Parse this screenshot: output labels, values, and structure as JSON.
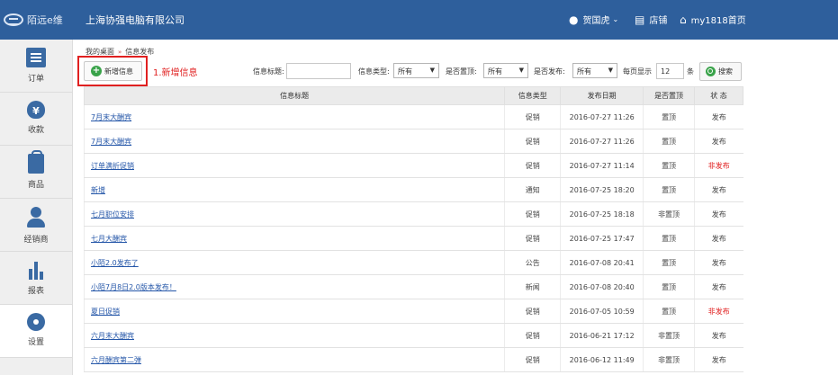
{
  "header": {
    "logo_text": "陌远e维",
    "company": "上海协强电脑有限公司",
    "user": "贺国虎",
    "shop": "店铺",
    "home": "my1818首页"
  },
  "sidebar": {
    "items": [
      {
        "label": "订单",
        "icon": "order-list-icon"
      },
      {
        "label": "收款",
        "icon": "money-bag-icon"
      },
      {
        "label": "商品",
        "icon": "goods-bag-icon"
      },
      {
        "label": "经销商",
        "icon": "dealer-person-icon"
      },
      {
        "label": "报表",
        "icon": "bar-chart-icon"
      },
      {
        "label": "设置",
        "icon": "gear-icon"
      }
    ]
  },
  "breadcrumb": {
    "root": "我的桌面",
    "separator": "»",
    "current": "信息发布"
  },
  "toolbar": {
    "add_label": "新增信息",
    "annotation": "1.新增信息",
    "title_label": "信息标题:",
    "title_value": "",
    "type_label": "信息类型:",
    "type_value": "所有",
    "top_label": "是否置顶:",
    "top_value": "所有",
    "publish_label": "是否发布:",
    "publish_value": "所有",
    "page_size_label": "每页显示",
    "page_size_value": "12",
    "page_size_unit": "条",
    "search_label": "搜索"
  },
  "table": {
    "headers": [
      "信息标题",
      "信息类型",
      "发布日期",
      "是否置顶",
      "状 态"
    ],
    "rows": [
      {
        "title": "7月末大酬宾",
        "type": "促销",
        "date": "2016-07-27 11:26",
        "top": "置顶",
        "status": "发布",
        "status_color": "#444444"
      },
      {
        "title": "7月末大酬宾",
        "type": "促销",
        "date": "2016-07-27 11:26",
        "top": "置顶",
        "status": "发布",
        "status_color": "#444444"
      },
      {
        "title": "订单满折促销",
        "type": "促销",
        "date": "2016-07-27 11:14",
        "top": "置顶",
        "status": "非发布",
        "status_color": "#e01c1c"
      },
      {
        "title": "新增",
        "type": "通知",
        "date": "2016-07-25 18:20",
        "top": "置顶",
        "status": "发布",
        "status_color": "#444444"
      },
      {
        "title": "七月职位安排",
        "type": "促销",
        "date": "2016-07-25 18:18",
        "top": "非置顶",
        "status": "发布",
        "status_color": "#444444"
      },
      {
        "title": "七月大酬宾",
        "type": "促销",
        "date": "2016-07-25 17:47",
        "top": "置顶",
        "status": "发布",
        "status_color": "#444444"
      },
      {
        "title": "小陌2.0发布了",
        "type": "公告",
        "date": "2016-07-08 20:41",
        "top": "置顶",
        "status": "发布",
        "status_color": "#444444"
      },
      {
        "title": "小陌7月8日2.0版本发布！",
        "type": "新闻",
        "date": "2016-07-08 20:40",
        "top": "置顶",
        "status": "发布",
        "status_color": "#444444"
      },
      {
        "title": "夏日促销",
        "type": "促销",
        "date": "2016-07-05 10:59",
        "top": "置顶",
        "status": "非发布",
        "status_color": "#e01c1c"
      },
      {
        "title": "六月末大酬宾",
        "type": "促销",
        "date": "2016-06-21 17:12",
        "top": "非置顶",
        "status": "发布",
        "status_color": "#444444"
      },
      {
        "title": "六月酬宾第二弹",
        "type": "促销",
        "date": "2016-06-12 11:49",
        "top": "非置顶",
        "status": "发布",
        "status_color": "#444444"
      }
    ]
  }
}
